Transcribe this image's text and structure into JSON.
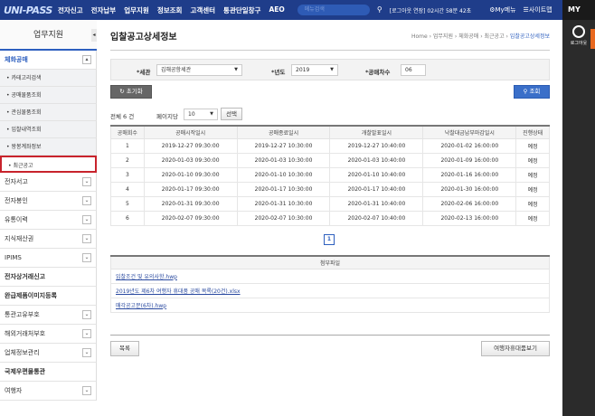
{
  "header": {
    "logo": "UNI-PASS",
    "nav": [
      "전자신고",
      "전자납부",
      "업무지원",
      "정보조회",
      "고객센터",
      "통관단일창구",
      "AEO"
    ],
    "search_placeholder": "메뉴검색",
    "session": "[로그아웃 연장] 02시간 58분 42초",
    "mymenu": "My메뉴",
    "sitemap": "사이트맵"
  },
  "right_panel": {
    "my": "MY",
    "logout": "로그아웃"
  },
  "sidebar": {
    "title": "업무지원",
    "section": "체화공매",
    "sub_items": [
      "카테고리검색",
      "공매물품조회",
      "관심물품조회",
      "입찰내역조회",
      "왕봉계좌정보",
      "최근공고"
    ],
    "items": [
      {
        "label": "전자서고",
        "expand": true
      },
      {
        "label": "전자봉인",
        "expand": true
      },
      {
        "label": "유통이력",
        "expand": true
      },
      {
        "label": "지식재산권",
        "expand": true
      },
      {
        "label": "IPIMS",
        "expand": true
      },
      {
        "label": "전자상거래신고",
        "expand": false
      },
      {
        "label": "완급제품이미지등록",
        "expand": false
      },
      {
        "label": "통관고유부호",
        "expand": true
      },
      {
        "label": "해외거래처부호",
        "expand": true
      },
      {
        "label": "업체정보관리",
        "expand": true
      },
      {
        "label": "국제우편물통관",
        "expand": false
      },
      {
        "label": "여행자",
        "expand": true
      }
    ]
  },
  "page": {
    "title": "입찰공고상세정보",
    "breadcrumb": [
      "Home",
      "업무지원",
      "체화공매",
      "최근공고",
      "입찰공고상세정보"
    ]
  },
  "filter": {
    "customs_label": "*세관",
    "customs_value": "김해공항세관",
    "year_label": "*년도",
    "year_value": "2019",
    "round_label": "*공매차수",
    "round_value": "06"
  },
  "buttons": {
    "reset": "초기화",
    "search": "조회",
    "select": "선택",
    "list": "목록",
    "view_goods": "여행자휴대품보기"
  },
  "list": {
    "total": "전체 6 건",
    "per_page_label": "페이지당",
    "per_page_value": "10",
    "columns": [
      "공매회수",
      "공매시작일시",
      "공매종료일시",
      "개찰발표일시",
      "낙찰대금납부마감일시",
      "진행상태"
    ],
    "rows": [
      [
        "1",
        "2019-12-27 09:30:00",
        "2019-12-27 10:30:00",
        "2019-12-27 10:40:00",
        "2020-01-02 16:00:00",
        "예정"
      ],
      [
        "2",
        "2020-01-03 09:30:00",
        "2020-01-03 10:30:00",
        "2020-01-03 10:40:00",
        "2020-01-09 16:00:00",
        "예정"
      ],
      [
        "3",
        "2020-01-10 09:30:00",
        "2020-01-10 10:30:00",
        "2020-01-10 10:40:00",
        "2020-01-16 16:00:00",
        "예정"
      ],
      [
        "4",
        "2020-01-17 09:30:00",
        "2020-01-17 10:30:00",
        "2020-01-17 10:40:00",
        "2020-01-30 16:00:00",
        "예정"
      ],
      [
        "5",
        "2020-01-31 09:30:00",
        "2020-01-31 10:30:00",
        "2020-01-31 10:40:00",
        "2020-02-06 16:00:00",
        "예정"
      ],
      [
        "6",
        "2020-02-07 09:30:00",
        "2020-02-07 10:30:00",
        "2020-02-07 10:40:00",
        "2020-02-13 16:00:00",
        "예정"
      ]
    ],
    "page": "1"
  },
  "attachments": {
    "header": "첨부파일",
    "files": [
      "입찰조건 및 유의사항.hwp",
      "2019년도 제6차 여행자 휴대품 공매 목록(20건).xlsx",
      "매각공고문(6차).hwp"
    ]
  }
}
